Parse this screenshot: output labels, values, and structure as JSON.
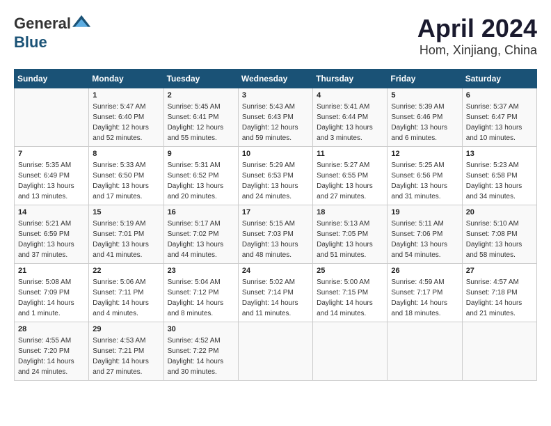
{
  "header": {
    "logo_general": "General",
    "logo_blue": "Blue",
    "month_title": "April 2024",
    "location": "Hom, Xinjiang, China"
  },
  "calendar": {
    "days_of_week": [
      "Sunday",
      "Monday",
      "Tuesday",
      "Wednesday",
      "Thursday",
      "Friday",
      "Saturday"
    ],
    "weeks": [
      [
        {
          "day": "",
          "info": ""
        },
        {
          "day": "1",
          "info": "Sunrise: 5:47 AM\nSunset: 6:40 PM\nDaylight: 12 hours\nand 52 minutes."
        },
        {
          "day": "2",
          "info": "Sunrise: 5:45 AM\nSunset: 6:41 PM\nDaylight: 12 hours\nand 55 minutes."
        },
        {
          "day": "3",
          "info": "Sunrise: 5:43 AM\nSunset: 6:43 PM\nDaylight: 12 hours\nand 59 minutes."
        },
        {
          "day": "4",
          "info": "Sunrise: 5:41 AM\nSunset: 6:44 PM\nDaylight: 13 hours\nand 3 minutes."
        },
        {
          "day": "5",
          "info": "Sunrise: 5:39 AM\nSunset: 6:46 PM\nDaylight: 13 hours\nand 6 minutes."
        },
        {
          "day": "6",
          "info": "Sunrise: 5:37 AM\nSunset: 6:47 PM\nDaylight: 13 hours\nand 10 minutes."
        }
      ],
      [
        {
          "day": "7",
          "info": "Sunrise: 5:35 AM\nSunset: 6:49 PM\nDaylight: 13 hours\nand 13 minutes."
        },
        {
          "day": "8",
          "info": "Sunrise: 5:33 AM\nSunset: 6:50 PM\nDaylight: 13 hours\nand 17 minutes."
        },
        {
          "day": "9",
          "info": "Sunrise: 5:31 AM\nSunset: 6:52 PM\nDaylight: 13 hours\nand 20 minutes."
        },
        {
          "day": "10",
          "info": "Sunrise: 5:29 AM\nSunset: 6:53 PM\nDaylight: 13 hours\nand 24 minutes."
        },
        {
          "day": "11",
          "info": "Sunrise: 5:27 AM\nSunset: 6:55 PM\nDaylight: 13 hours\nand 27 minutes."
        },
        {
          "day": "12",
          "info": "Sunrise: 5:25 AM\nSunset: 6:56 PM\nDaylight: 13 hours\nand 31 minutes."
        },
        {
          "day": "13",
          "info": "Sunrise: 5:23 AM\nSunset: 6:58 PM\nDaylight: 13 hours\nand 34 minutes."
        }
      ],
      [
        {
          "day": "14",
          "info": "Sunrise: 5:21 AM\nSunset: 6:59 PM\nDaylight: 13 hours\nand 37 minutes."
        },
        {
          "day": "15",
          "info": "Sunrise: 5:19 AM\nSunset: 7:01 PM\nDaylight: 13 hours\nand 41 minutes."
        },
        {
          "day": "16",
          "info": "Sunrise: 5:17 AM\nSunset: 7:02 PM\nDaylight: 13 hours\nand 44 minutes."
        },
        {
          "day": "17",
          "info": "Sunrise: 5:15 AM\nSunset: 7:03 PM\nDaylight: 13 hours\nand 48 minutes."
        },
        {
          "day": "18",
          "info": "Sunrise: 5:13 AM\nSunset: 7:05 PM\nDaylight: 13 hours\nand 51 minutes."
        },
        {
          "day": "19",
          "info": "Sunrise: 5:11 AM\nSunset: 7:06 PM\nDaylight: 13 hours\nand 54 minutes."
        },
        {
          "day": "20",
          "info": "Sunrise: 5:10 AM\nSunset: 7:08 PM\nDaylight: 13 hours\nand 58 minutes."
        }
      ],
      [
        {
          "day": "21",
          "info": "Sunrise: 5:08 AM\nSunset: 7:09 PM\nDaylight: 14 hours\nand 1 minute."
        },
        {
          "day": "22",
          "info": "Sunrise: 5:06 AM\nSunset: 7:11 PM\nDaylight: 14 hours\nand 4 minutes."
        },
        {
          "day": "23",
          "info": "Sunrise: 5:04 AM\nSunset: 7:12 PM\nDaylight: 14 hours\nand 8 minutes."
        },
        {
          "day": "24",
          "info": "Sunrise: 5:02 AM\nSunset: 7:14 PM\nDaylight: 14 hours\nand 11 minutes."
        },
        {
          "day": "25",
          "info": "Sunrise: 5:00 AM\nSunset: 7:15 PM\nDaylight: 14 hours\nand 14 minutes."
        },
        {
          "day": "26",
          "info": "Sunrise: 4:59 AM\nSunset: 7:17 PM\nDaylight: 14 hours\nand 18 minutes."
        },
        {
          "day": "27",
          "info": "Sunrise: 4:57 AM\nSunset: 7:18 PM\nDaylight: 14 hours\nand 21 minutes."
        }
      ],
      [
        {
          "day": "28",
          "info": "Sunrise: 4:55 AM\nSunset: 7:20 PM\nDaylight: 14 hours\nand 24 minutes."
        },
        {
          "day": "29",
          "info": "Sunrise: 4:53 AM\nSunset: 7:21 PM\nDaylight: 14 hours\nand 27 minutes."
        },
        {
          "day": "30",
          "info": "Sunrise: 4:52 AM\nSunset: 7:22 PM\nDaylight: 14 hours\nand 30 minutes."
        },
        {
          "day": "",
          "info": ""
        },
        {
          "day": "",
          "info": ""
        },
        {
          "day": "",
          "info": ""
        },
        {
          "day": "",
          "info": ""
        }
      ]
    ]
  }
}
